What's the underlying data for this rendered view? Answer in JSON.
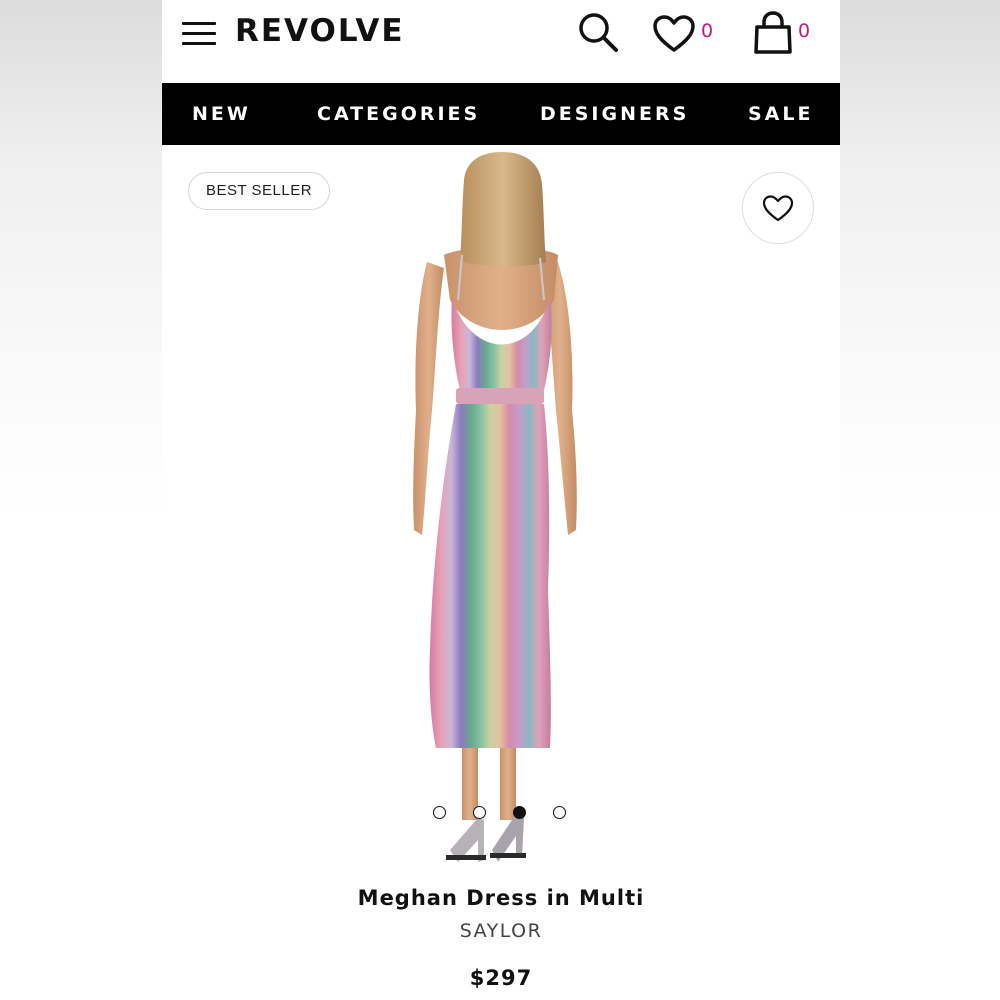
{
  "header": {
    "logo": "REVOLVE",
    "menu_icon": "hamburger-menu-icon",
    "search_icon": "search-icon",
    "wishlist_icon": "heart-icon",
    "wishlist_count": "0",
    "bag_icon": "shopping-bag-icon",
    "bag_count": "0",
    "count_color": "#c2188a"
  },
  "nav": {
    "items": [
      {
        "label": "NEW"
      },
      {
        "label": "CATEGORIES"
      },
      {
        "label": "DESIGNERS"
      },
      {
        "label": "SALE"
      }
    ]
  },
  "product": {
    "badge": "BEST SELLER",
    "favorite_icon": "heart-outline-icon",
    "image_count": 4,
    "active_image_index": 2,
    "name": "Meghan Dress in Multi",
    "brand": "SAYLOR",
    "price": "$297"
  }
}
